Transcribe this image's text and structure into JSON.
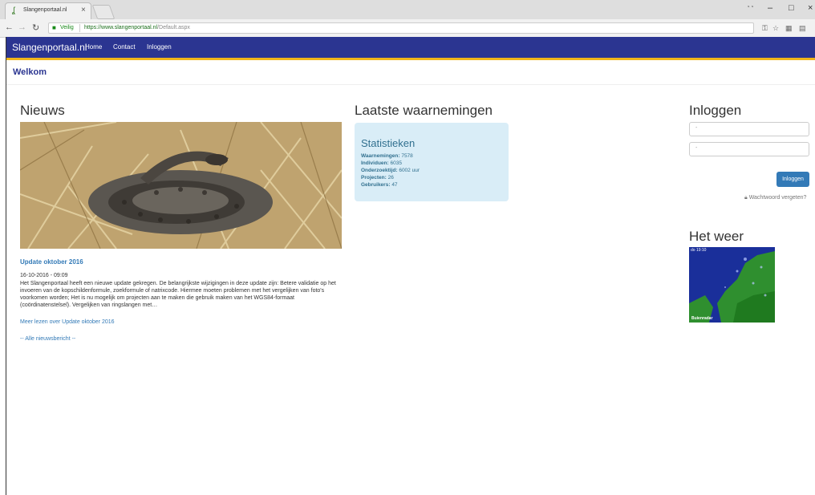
{
  "browser": {
    "tab_title": "Slangenportaal.nl",
    "tab_close": "×",
    "secure_label": "Veilig",
    "url_scheme_host": "https://www.slangenportaal.nl",
    "url_path": "/Default.aspx",
    "window_controls": {
      "minimize": "–",
      "maximize": "□",
      "close": "×"
    }
  },
  "site": {
    "brand": "Slangenportaal.nl",
    "nav": [
      "Home",
      "Contact",
      "Inloggen"
    ],
    "welcome": "Welkom"
  },
  "news": {
    "heading": "Nieuws",
    "title": "Update oktober 2016",
    "date": "16-10-2016 - 09:09",
    "body": "Het Slangenportaal heeft een nieuwe update gekregen. De belangrijkste wijzigingen in deze update zijn: Betere validatie op het invoeren van de kopschildenformule, zoekformule of natrixcode. Hiermee moeten problemen met het vergelijken van foto's voorkomen worden; Het is nu mogelijk om projecten aan te maken die gebruik maken van het WGS84-formaat (coördinatenstelsel). Vergelijken van ringslangen met…",
    "more_link": "Meer lezen over Update oktober 2016",
    "all_link": "-- Alle nieuwsbericht --"
  },
  "observations": {
    "heading": "Laatste waarnemingen",
    "stats_title": "Statistieken",
    "stats": [
      {
        "label": "Waarnemingen:",
        "value": "7578"
      },
      {
        "label": "Individuen:",
        "value": "6035"
      },
      {
        "label": "Onderzoektijd:",
        "value": "6002 uur"
      },
      {
        "label": "Projecten:",
        "value": "26"
      },
      {
        "label": "Gebruikers:",
        "value": "47"
      }
    ]
  },
  "login": {
    "heading": "Inloggen",
    "username_placeholder": "-",
    "password_placeholder": "-",
    "button": "Inloggen",
    "forgot": "Wachtwoord vergeten?"
  },
  "weather": {
    "heading": "Het weer",
    "time": "do 19:10",
    "brand": "Buienradar"
  }
}
